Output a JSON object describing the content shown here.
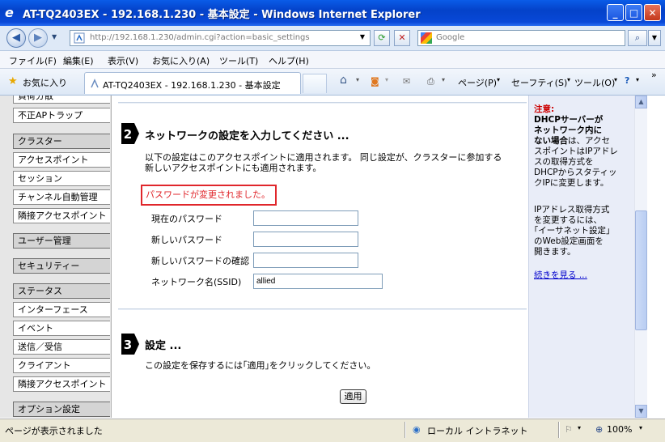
{
  "window": {
    "title": "AT-TQ2403EX - 192.168.1.230 - 基本設定 - Windows Internet Explorer",
    "controls": {
      "minimize": "_",
      "maximize": "□",
      "close": "✕"
    }
  },
  "address_bar": {
    "url": "http://192.168.1.230/admin.cgi?action=basic_settings",
    "search_placeholder": "Google"
  },
  "menu": [
    "ファイル(F)",
    "編集(E)",
    "表示(V)",
    "お気に入り(A)",
    "ツール(T)",
    "ヘルプ(H)"
  ],
  "favorites_bar": {
    "favorites_label": "お気に入り",
    "tab_title": "AT-TQ2403EX - 192.168.1.230 - 基本設定",
    "page_menu": "ページ(P)",
    "safety_menu": "セーフティ(S)",
    "tools_menu": "ツール(O)",
    "more": "»"
  },
  "sidebar": {
    "items": [
      {
        "label": "負荷分散",
        "category": false
      },
      {
        "label": "不正APトラップ",
        "category": false
      },
      {
        "label": "クラスター",
        "category": true
      },
      {
        "label": "アクセスポイント",
        "category": false
      },
      {
        "label": "セッション",
        "category": false
      },
      {
        "label": "チャンネル自動管理",
        "category": false
      },
      {
        "label": "隣接アクセスポイント",
        "category": false
      },
      {
        "label": "ユーザー管理",
        "category": true
      },
      {
        "label": "セキュリティー",
        "category": true
      },
      {
        "label": "ステータス",
        "category": true
      },
      {
        "label": "インターフェース",
        "category": false
      },
      {
        "label": "イベント",
        "category": false
      },
      {
        "label": "送信／受信",
        "category": false
      },
      {
        "label": "クライアント",
        "category": false
      },
      {
        "label": "隣接アクセスポイント",
        "category": false
      },
      {
        "label": "オプション設定",
        "category": true
      }
    ]
  },
  "main": {
    "step2": {
      "number": "2",
      "heading": "ネットワークの設定を入力してください ...",
      "description_line1": "以下の設定はこのアクセスポイントに適用されます。 同じ設定が、クラスターに参加する",
      "description_line2": "新しいアクセスポイントにも適用されます。",
      "notice": "パスワードが変更されました。",
      "fields": {
        "current_password_label": "現在のパスワード",
        "current_password_value": "",
        "new_password_label": "新しいパスワード",
        "new_password_value": "",
        "confirm_password_label": "新しいパスワードの確認",
        "confirm_password_value": "",
        "ssid_label": "ネットワーク名(SSID)",
        "ssid_value": "allied"
      }
    },
    "step3": {
      "number": "3",
      "heading": "設定 ...",
      "description": "この設定を保存するには｢適用｣をクリックしてください。",
      "apply_label": "適用"
    }
  },
  "right_panel": {
    "note_title": "注意:",
    "note_bold_1": "DHCPサーバーが",
    "note_bold_2": "ネットワーク内に",
    "note_bold_3": "ない場合",
    "note_rest_1": "は、アクセ",
    "note_rest_2": "スポイントはIPアドレ",
    "note_rest_3": "スの取得方式を",
    "note_rest_4": "DHCPからスタティッ",
    "note_rest_5": "クIPに変更します。",
    "para2_1": "IPアドレス取得方式",
    "para2_2": "を変更するには、",
    "para2_3": "｢イーサネット設定｣",
    "para2_4": "のWeb設定画面を",
    "para2_5": "開きます。",
    "more_link": "続きを見る ..."
  },
  "status_bar": {
    "text": "ページが表示されました",
    "zone": "ローカル イントラネット",
    "zoom": "100%"
  },
  "colors": {
    "notice_red": "#e0262b",
    "link_blue": "#0000cc",
    "note_red": "#cc0000",
    "titlebar_blue": "#0a5ce8"
  }
}
